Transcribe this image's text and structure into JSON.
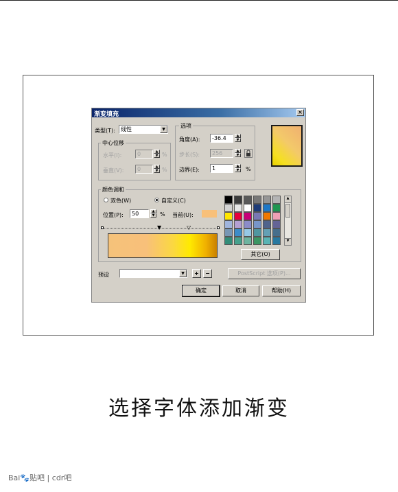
{
  "caption": "选择字体添加渐变",
  "footer": {
    "logo": "Bai",
    "logo_paw": "🐾",
    "site": "贴吧",
    "sep": "|",
    "forum": "cdr吧"
  },
  "dialog": {
    "title": "渐变填充",
    "close_label": "×",
    "type_label": "类型(T):",
    "type_value": "线性",
    "center_group": "中心位移",
    "horizontal_label": "水平(I):",
    "horizontal_value": "0",
    "vertical_label": "垂直(V):",
    "vertical_value": "0",
    "percent": "%",
    "options_group": "选项",
    "angle_label": "角度(A):",
    "angle_value": "-36.4",
    "steps_label": "步长(S):",
    "steps_value": "256",
    "edge_label": "边界(E):",
    "edge_value": "1",
    "color_blend_group": "颜色调和",
    "two_color_label": "双色(W)",
    "custom_label": "自定义(C)",
    "position_label": "位置(P):",
    "position_value": "50",
    "current_label": "当前(U):",
    "current_color": "#f8c07a",
    "other_button": "其它(O)",
    "preset_label": "预设",
    "preset_value": "",
    "postscript_button": "PostScript 选项(P)...",
    "ok_button": "确定",
    "cancel_button": "取消",
    "help_button": "帮助(H)",
    "plus_label": "+",
    "minus_label": "−"
  },
  "palette": [
    [
      "#000000",
      "#3c3c3c",
      "#5a5a5a",
      "#787878",
      "#969696",
      "#b4b4b4"
    ],
    [
      "#d2d2d2",
      "#e6e6e6",
      "#ffffff",
      "#1e3c78",
      "#1e78c8",
      "#1e9650"
    ],
    [
      "#ffe600",
      "#e6003c",
      "#c80078",
      "#7878b4",
      "#f07800",
      "#f0a0b4"
    ],
    [
      "#a0b4dc",
      "#b4a0d2",
      "#8c8cc8",
      "#7896c8",
      "#50648c",
      "#646496"
    ],
    [
      "#7896b4",
      "#3c8cc8",
      "#96c8e6",
      "#5096a0",
      "#64a0b4",
      "#466e8c"
    ],
    [
      "#328c78",
      "#46a08c",
      "#6eb4a0",
      "#3c9664",
      "#5ab4b4",
      "#2878a0"
    ]
  ]
}
